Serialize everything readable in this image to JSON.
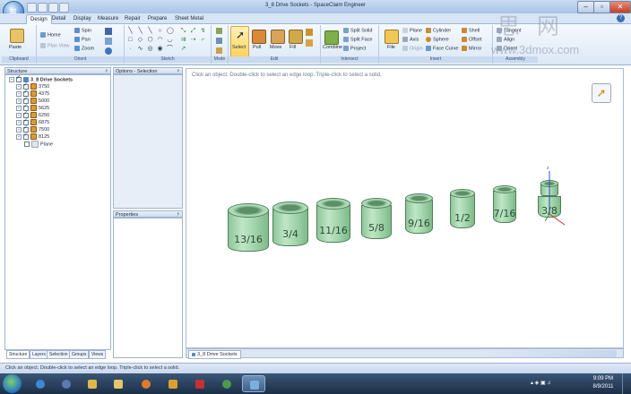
{
  "window": {
    "title": "3_8 Drive Sockets - SpaceClaim Engineer"
  },
  "tabs": [
    "Design",
    "Detail",
    "Display",
    "Measure",
    "Repair",
    "Prepare",
    "Sheet Metal"
  ],
  "ribbon": {
    "clipboard": {
      "label": "Clipboard",
      "paste": "Paste"
    },
    "orient": {
      "label": "Orient",
      "home": "Home",
      "plan_view": "Plan View",
      "spin": "Spin",
      "pan": "Pan",
      "zoom": "Zoom"
    },
    "sketch": {
      "label": "Sketch"
    },
    "mode": {
      "label": "Mode"
    },
    "edit": {
      "label": "Edit",
      "select": "Select",
      "pull": "Pull",
      "move": "Move",
      "fill": "Fill"
    },
    "intersect": {
      "label": "Intersect",
      "combine": "Combine",
      "split_solid": "Split Solid",
      "split_face": "Split Face",
      "project": "Project"
    },
    "insert": {
      "label": "Insert",
      "file": "File",
      "plane": "Plane",
      "axis": "Axis",
      "origin": "Origin",
      "cylinder": "Cylinder",
      "sphere": "Sphere",
      "face_curve": "Face Curve",
      "shell": "Shell",
      "offset": "Offset",
      "mirror": "Mirror",
      "tangent": "Tangent",
      "align": "Align",
      "orient": "Orient",
      "assembly": "Assembly"
    }
  },
  "structure": {
    "header": "Structure",
    "root": "3_8 Drive Sockets",
    "items": [
      "3750",
      "4375",
      "5000",
      "5625",
      "6250",
      "6875",
      "7500",
      "8125"
    ],
    "plane": "Plane",
    "tabs": [
      "Structure",
      "Layers",
      "Selection",
      "Groups",
      "Views"
    ]
  },
  "options": {
    "header": "Options - Selection"
  },
  "properties": {
    "header": "Properties"
  },
  "viewport": {
    "hint": "Click an object. Double-click to select an edge loop. Triple-click to select a solid.",
    "sockets": [
      "13/16",
      "3/4",
      "11/16",
      "5/8",
      "9/16",
      "1/2",
      "7/16",
      "3/8"
    ],
    "axis_z": "z",
    "doc_tab": "3_8 Drive Sockets"
  },
  "status": {
    "text": "Click an object. Double-click to select an edge loop. Triple-click to select a solid."
  },
  "taskbar": {
    "time": "9:09 PM",
    "date": "8/9/2011"
  },
  "watermark": {
    "chars": "思 网",
    "site": "www.3dmox.com"
  }
}
